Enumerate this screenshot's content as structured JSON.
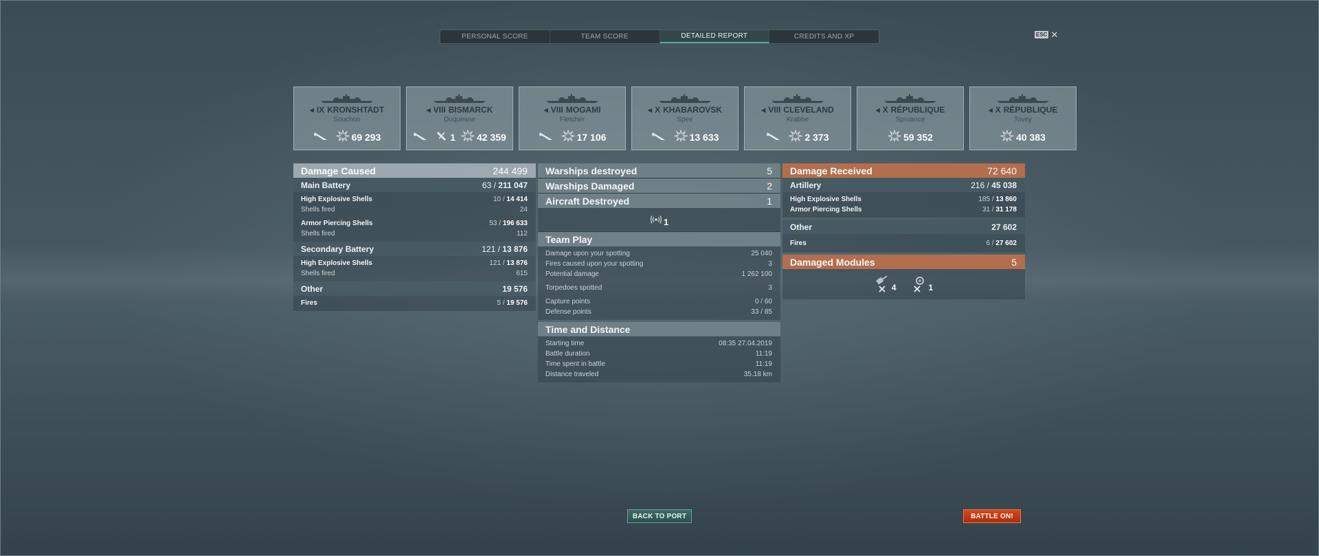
{
  "tabs": [
    {
      "label": "PERSONAL SCORE",
      "active": false
    },
    {
      "label": "TEAM SCORE",
      "active": false
    },
    {
      "label": "DETAILED REPORT",
      "active": true
    },
    {
      "label": "CREDITS AND XP",
      "active": false
    }
  ],
  "close": {
    "key": "ESC",
    "icon": "close-icon"
  },
  "ships": [
    {
      "tier": "IX",
      "name": "KRONSHTADT",
      "player": "Souchon",
      "stats": [
        {
          "icon": "shell-hit-icon",
          "value": ""
        },
        {
          "icon": "damage-icon",
          "value": "69 293"
        }
      ]
    },
    {
      "tier": "VIII",
      "name": "BISMARCK",
      "player": "Duquesne",
      "stats": [
        {
          "icon": "shell-hit-icon",
          "value": ""
        },
        {
          "icon": "secondary-hit-icon",
          "value": "1"
        },
        {
          "icon": "damage-icon",
          "value": "42 359"
        }
      ]
    },
    {
      "tier": "VIII",
      "name": "MOGAMI",
      "player": "Fletcher",
      "stats": [
        {
          "icon": "shell-hit-icon",
          "value": ""
        },
        {
          "icon": "damage-icon",
          "value": "17 106"
        }
      ]
    },
    {
      "tier": "X",
      "name": "KHABAROVSK",
      "player": "Spee",
      "stats": [
        {
          "icon": "shell-hit-icon",
          "value": ""
        },
        {
          "icon": "damage-icon",
          "value": "13 633"
        }
      ]
    },
    {
      "tier": "VIII",
      "name": "CLEVELAND",
      "player": "Krabbe",
      "stats": [
        {
          "icon": "shell-hit-icon",
          "value": ""
        },
        {
          "icon": "damage-icon",
          "value": "2 373"
        }
      ]
    },
    {
      "tier": "X",
      "name": "RÉPUBLIQUE",
      "player": "Spruance",
      "stats": [
        {
          "icon": "damage-icon",
          "value": "59 352"
        }
      ]
    },
    {
      "tier": "X",
      "name": "RÉPUBLIQUE",
      "player": "Tovey",
      "stats": [
        {
          "icon": "damage-icon",
          "value": "40 383"
        }
      ]
    }
  ],
  "damage_caused": {
    "title": "Damage Caused",
    "total": "244 499",
    "main_battery": {
      "title": "Main Battery",
      "hits": "63",
      "damage": "211 047",
      "he_label": "High Explosive Shells",
      "he_hits": "10",
      "he_damage": "14 414",
      "he_fired_label": "Shells fired",
      "he_fired": "24",
      "ap_label": "Armor Piercing Shells",
      "ap_hits": "53",
      "ap_damage": "196 633",
      "ap_fired_label": "Shells fired",
      "ap_fired": "112"
    },
    "secondary_battery": {
      "title": "Secondary Battery",
      "hits": "121",
      "damage": "13 876",
      "he_label": "High Explosive Shells",
      "he_hits": "121",
      "he_damage": "13 876",
      "fired_label": "Shells fired",
      "fired": "615"
    },
    "other": {
      "title": "Other",
      "total": "19 576",
      "fires_label": "Fires",
      "fires_count": "5",
      "fires_damage": "19 576"
    }
  },
  "center": {
    "warships_destroyed_label": "Warships destroyed",
    "warships_destroyed": "5",
    "warships_damaged_label": "Warships Damaged",
    "warships_damaged": "2",
    "aircraft_destroyed_label": "Aircraft Destroyed",
    "aircraft_destroyed": "1",
    "spotted_count": "1",
    "team_play": {
      "title": "Team Play",
      "rows": [
        {
          "label": "Damage upon your spotting",
          "value": "25 040"
        },
        {
          "label": "Fires caused upon your spotting",
          "value": "3"
        },
        {
          "label": "Potential damage",
          "value": "1 262 100"
        },
        {
          "label": "Torpedoes spotted",
          "value": "3"
        },
        {
          "label": "Capture points",
          "value": "0 / 60"
        },
        {
          "label": "Defense points",
          "value": "33 / 85"
        }
      ]
    },
    "time_distance": {
      "title": "Time and Distance",
      "rows": [
        {
          "label": "Starting time",
          "value": "08:35  27.04.2019"
        },
        {
          "label": "Battle duration",
          "value": "11:19"
        },
        {
          "label": "Time spent in battle",
          "value": "11:19"
        },
        {
          "label": "Distance traveled",
          "value": "35.18 km"
        }
      ]
    }
  },
  "damage_received": {
    "title": "Damage Received",
    "total": "72 640",
    "artillery": {
      "title": "Artillery",
      "hits": "216",
      "damage": "45 038",
      "he_label": "High Explosive Shells",
      "he_hits": "185",
      "he_damage": "13 860",
      "ap_label": "Armor Piercing Shells",
      "ap_hits": "31",
      "ap_damage": "31 178"
    },
    "other": {
      "title": "Other",
      "total": "27 602",
      "fires_label": "Fires",
      "fires_count": "6",
      "fires_damage": "27 602"
    },
    "modules": {
      "title": "Damaged Modules",
      "total": "5",
      "items": [
        {
          "icon": "turret-destroyed-icon",
          "count": "4"
        },
        {
          "icon": "engine-destroyed-icon",
          "count": "1"
        }
      ]
    }
  },
  "buttons": {
    "back": "BACK TO PORT",
    "battle": "BATTLE ON!"
  },
  "colors": {
    "accent_teal": "#5aa7a3",
    "received_orange": "#b36e4e",
    "battle_red": "#d9461b"
  }
}
